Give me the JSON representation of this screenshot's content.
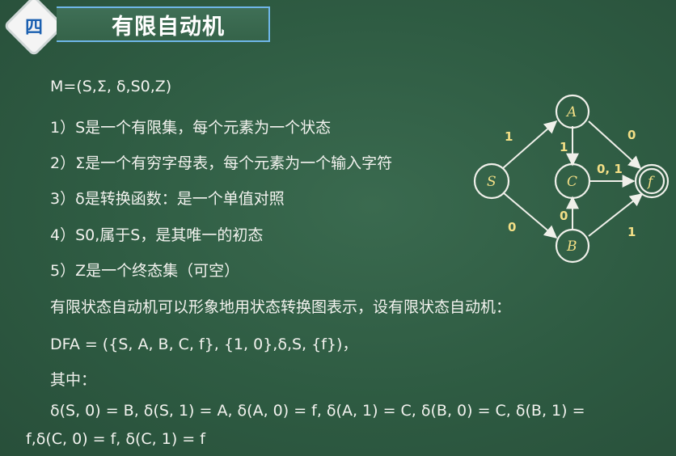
{
  "header": {
    "badge": "四",
    "title": "有限自动机"
  },
  "content": {
    "line1": "M=(S,Σ, δ,S0,Z)",
    "line2": "1）S是一个有限集，每个元素为一个状态",
    "line3": "2）Σ是一个有穷字母表，每个元素为一个输入字符",
    "line4": "3）δ是转换函数：是一个单值对照",
    "line5": "4）S0,属于S，是其唯一的初态",
    "line6": "5）Z是一个终态集（可空）",
    "line7": "有限状态自动机可以形象地用状态转换图表示，设有限状态自动机：",
    "line8": "DFA = ({S, A, B, C, f}, {1, 0},δ,S, {f})，",
    "line9": "其中：",
    "line10": "δ(S, 0) = B, δ(S, 1) = A, δ(A, 0) = f, δ(A, 1) = C, δ(B, 0) = C, δ(B, 1) =",
    "line11": "f,δ(C, 0) = f, δ(C, 1) = f"
  },
  "diagram": {
    "nodes": {
      "S": "S",
      "A": "A",
      "C": "C",
      "B": "B",
      "f": "f"
    },
    "edges": {
      "S_A": "1",
      "S_B": "0",
      "A_f": "0",
      "A_C": "1",
      "B_C": "0",
      "B_f": "1",
      "C_f": "0, 1"
    }
  }
}
